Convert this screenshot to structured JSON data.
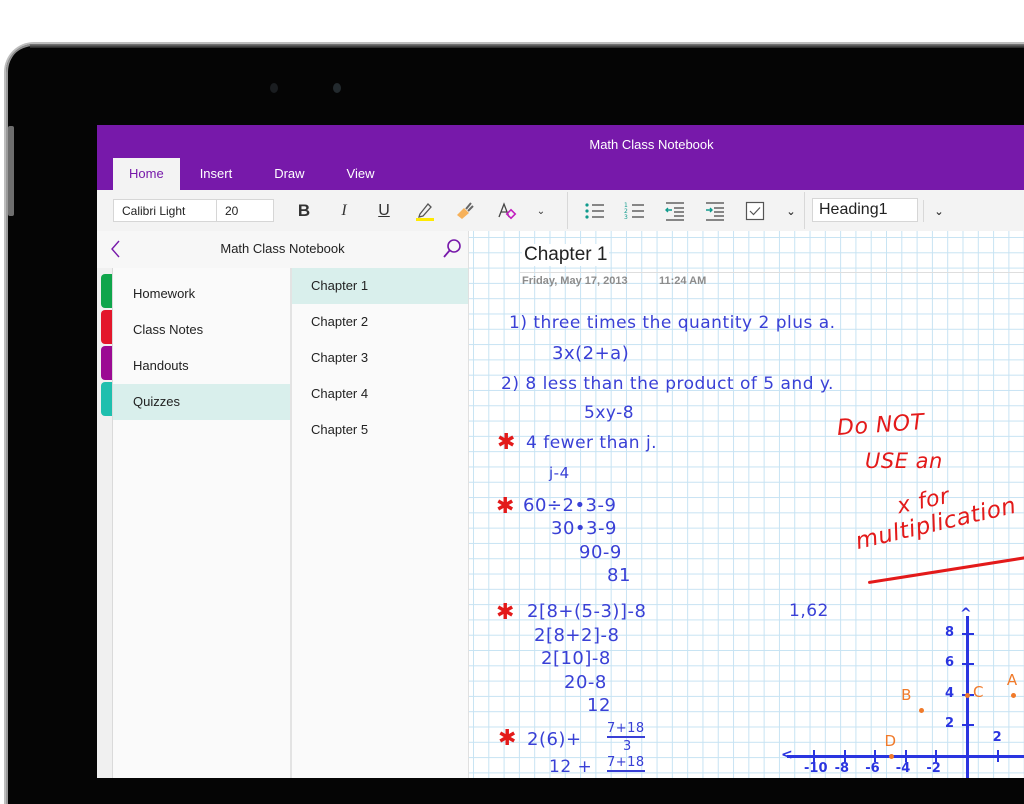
{
  "app": {
    "title": "Math Class Notebook"
  },
  "ribbon": {
    "tabs": [
      {
        "label": "Home",
        "active": true
      },
      {
        "label": "Insert",
        "active": false
      },
      {
        "label": "Draw",
        "active": false
      },
      {
        "label": "View",
        "active": false
      }
    ],
    "font_name": "Calibri Light",
    "font_size": "20",
    "bold_label": "B",
    "italic_label": "I",
    "underline_label": "U",
    "style_value": "Heading1",
    "highlight_color": "#ffff00",
    "icons": [
      "bold-icon",
      "italic-icon",
      "underline-icon",
      "highlighter-icon",
      "format-painter-icon",
      "clear-formatting-icon",
      "chevron-down-icon",
      "bullet-list-icon",
      "numbered-list-icon",
      "outdent-icon",
      "indent-icon",
      "todo-checkbox-icon",
      "chevron-down-icon",
      "chevron-down-icon"
    ]
  },
  "navigation": {
    "header_title": "Math Class Notebook",
    "sections": [
      {
        "label": "Homework",
        "color": "#0fa54b",
        "selected": false
      },
      {
        "label": "Class Notes",
        "color": "#e3172b",
        "selected": false
      },
      {
        "label": "Handouts",
        "color": "#9b0a93",
        "selected": false
      },
      {
        "label": "Quizzes",
        "color": "#1fbfae",
        "selected": true
      }
    ],
    "pages": [
      {
        "label": "Chapter 1",
        "selected": true
      },
      {
        "label": "Chapter 2",
        "selected": false
      },
      {
        "label": "Chapter 3",
        "selected": false
      },
      {
        "label": "Chapter 4",
        "selected": false
      },
      {
        "label": "Chapter 5",
        "selected": false
      }
    ]
  },
  "page": {
    "title": "Chapter 1",
    "date": "Friday, May 17, 2013",
    "time": "11:24 AM",
    "ink": {
      "problem1": "1) three times the quantity 2 plus a.",
      "answer1": "3x(2+a)",
      "problem2": "2) 8 less than the product of 5 and y.",
      "answer2": "5xy-8",
      "problem3": "4 fewer than j.",
      "answer3": "j-4",
      "problem4": "60÷2•3-9",
      "step4a": "30•3-9",
      "step4b": "90-9",
      "step4c": "81",
      "problem5": "2[8+(5-3)]-8",
      "step5a": "2[8+2]-8",
      "step5b": "2[10]-8",
      "step5c": "20-8",
      "step5d": "12",
      "problem6": "2(6)+",
      "frac6_num": "7+18",
      "frac6_den": "3",
      "step6a": "12 +",
      "frac6b_num": "7+18",
      "side_note": "1,62",
      "teacher_note_lines": [
        "Do NOT",
        "USE an",
        "x for",
        "multiplication"
      ],
      "mark_symbol": "✱"
    },
    "graph": {
      "x_ticks": [
        "-10",
        "-8",
        "-6",
        "-4",
        "-2",
        "2"
      ],
      "y_ticks": [
        "8",
        "6",
        "4",
        "2"
      ],
      "points": [
        {
          "label": "A",
          "x": 3,
          "y": 4
        },
        {
          "label": "B",
          "x": -3,
          "y": 3
        },
        {
          "label": "C",
          "x": 0,
          "y": 4
        },
        {
          "label": "D",
          "x": -5,
          "y": 0
        }
      ]
    }
  }
}
